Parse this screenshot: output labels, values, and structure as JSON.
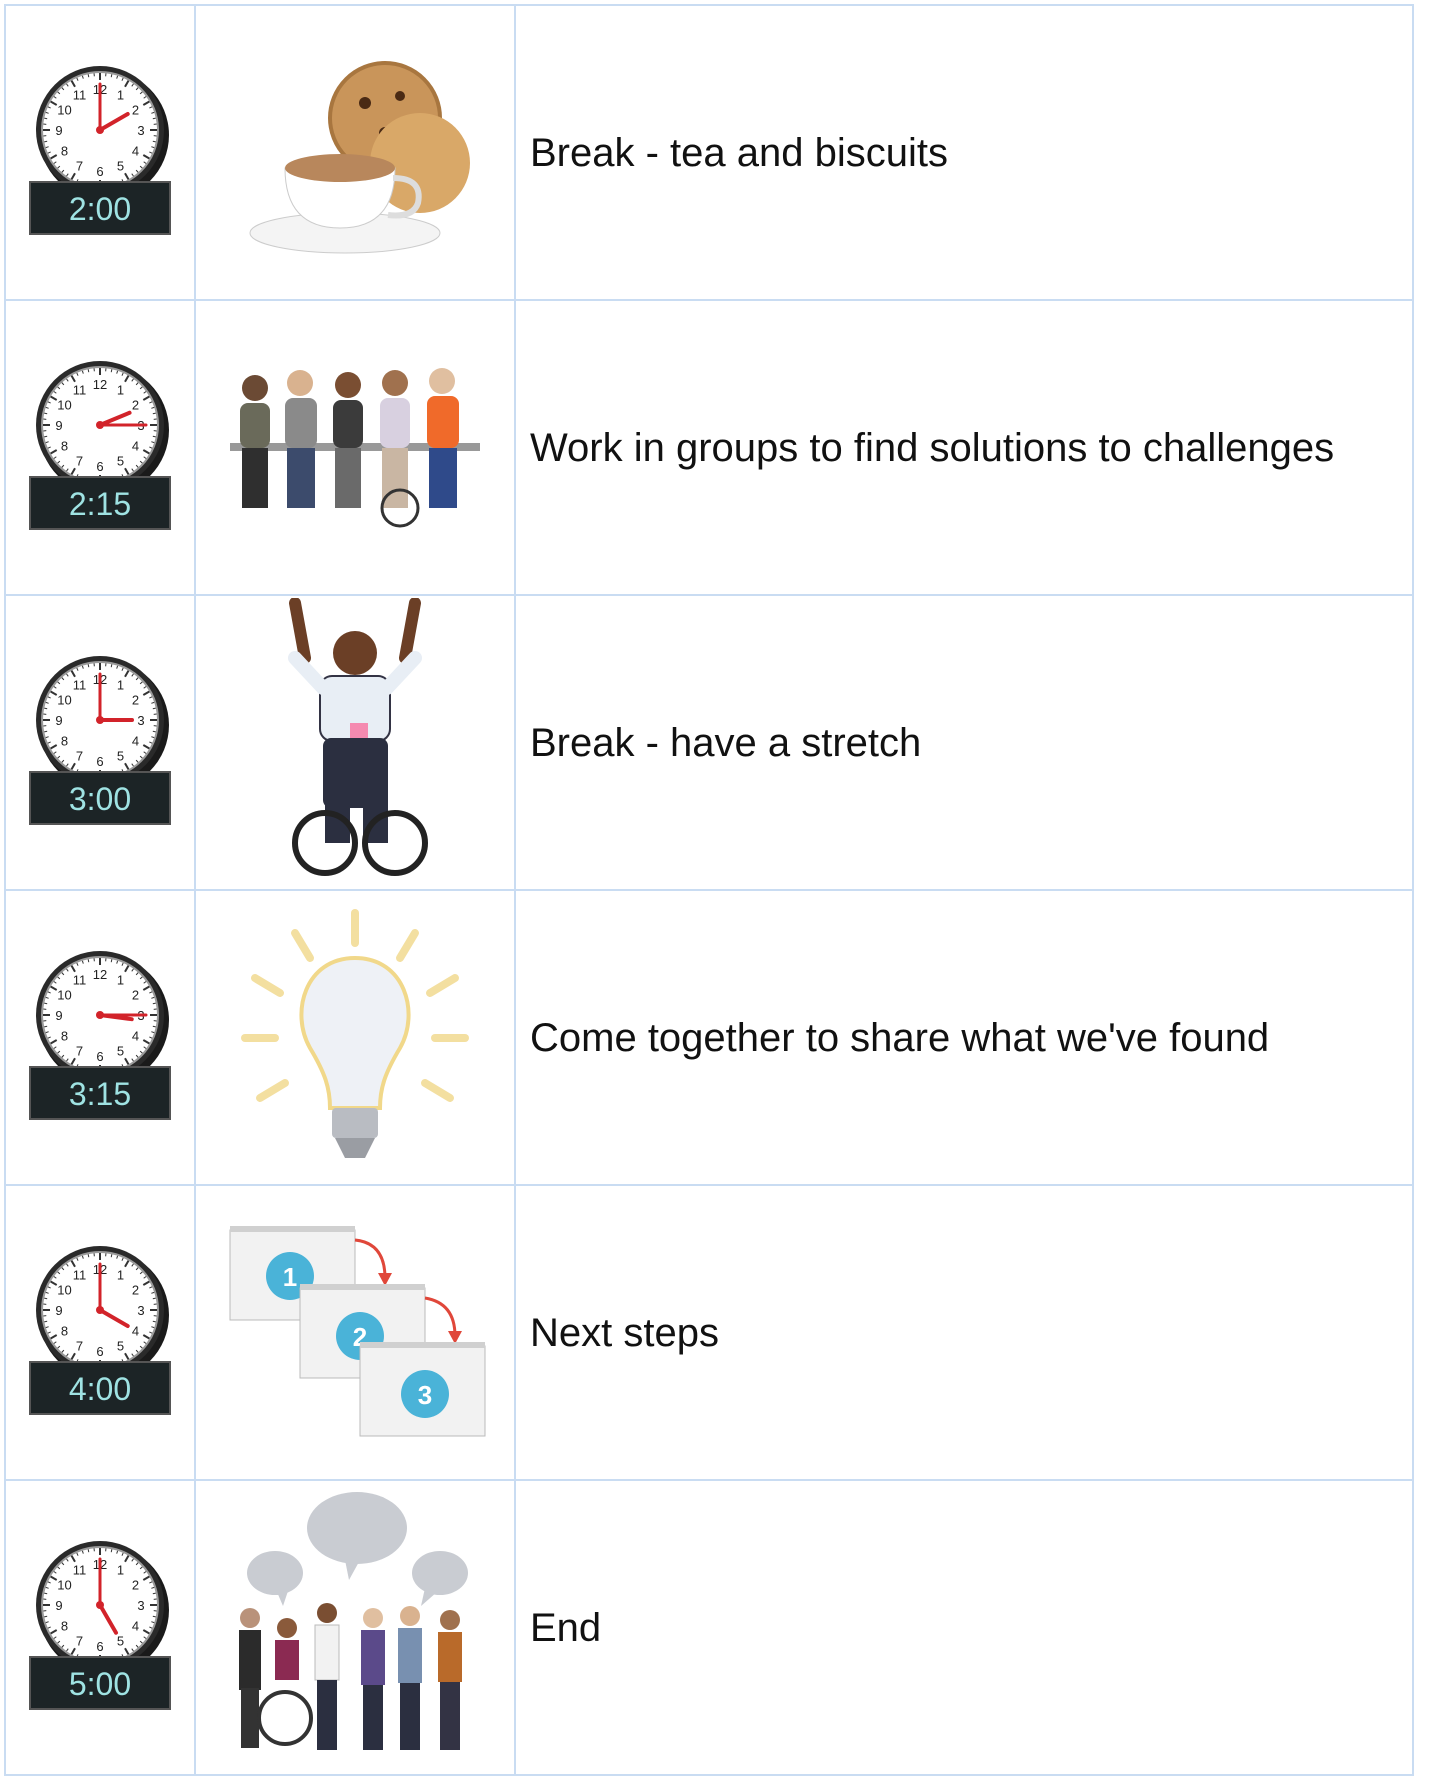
{
  "rows": [
    {
      "time": "2:00",
      "hour": 2,
      "minute": 0,
      "picture": "tea-and-biscuits",
      "activity": "Break - tea and biscuits"
    },
    {
      "time": "2:15",
      "hour": 2,
      "minute": 15,
      "picture": "group-of-people-talking",
      "activity": "Work in groups to find solutions to challenges"
    },
    {
      "time": "3:00",
      "hour": 3,
      "minute": 0,
      "picture": "person-in-wheelchair-stretching",
      "activity": "Break - have a stretch"
    },
    {
      "time": "3:15",
      "hour": 3,
      "minute": 15,
      "picture": "lightbulb",
      "activity": "Come together to share what we've found"
    },
    {
      "time": "4:00",
      "hour": 4,
      "minute": 0,
      "picture": "numbered-steps",
      "activity": "Next steps"
    },
    {
      "time": "5:00",
      "hour": 5,
      "minute": 0,
      "picture": "people-talking-speech-bubbles",
      "activity": "End"
    }
  ],
  "steps": [
    "1",
    "2",
    "3"
  ],
  "clock_numbers": [
    "12",
    "1",
    "2",
    "3",
    "4",
    "5",
    "6",
    "7",
    "8",
    "9",
    "10",
    "11"
  ],
  "colors": {
    "border": "#c9dcf2",
    "clock_hand": "#d2232a",
    "digital_bg": "#1c2426",
    "digital_text": "#9fe3e3",
    "step_circle": "#4ab3d8",
    "arrow": "#e0473a",
    "bulb_rays": "#f3dfa0"
  }
}
